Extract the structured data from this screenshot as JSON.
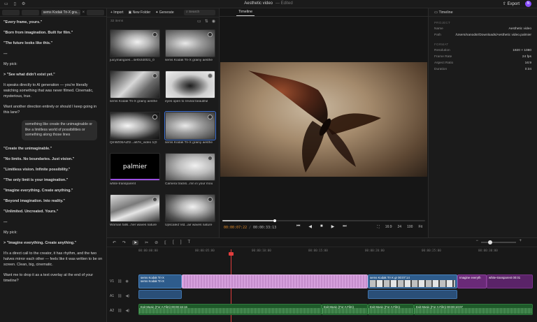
{
  "app": {
    "title": "Aesthetic video",
    "subtitle": "— Edited",
    "export_label": "Export",
    "avatar_initial": "N"
  },
  "chat": {
    "active_tab": "sems Kodak Tri-X gra...",
    "messages": [
      {
        "text": "\"Every frame, yours.\"",
        "bold": true
      },
      {
        "text": "\"Born from imagination. Built for film.\"",
        "bold": true
      },
      {
        "text": "\"The future looks like this.\"",
        "bold": true
      },
      {
        "text": "---",
        "bold": true
      },
      {
        "text": "My pick:",
        "bold": false
      },
      {
        "text": "> \"See what didn't exist yet.\"",
        "bold": true
      },
      {
        "text": "It speaks directly to AI generation — you're literally watching something that was never filmed. Cinematic, mysterious, true.",
        "bold": false
      },
      {
        "text": "Want another direction entirely or should I keep going in this lane?",
        "bold": false
      }
    ],
    "user_bubble": "something like create the unimaginable or like a limitless world of possibilities or something along those lines",
    "messages2": [
      {
        "text": "\"Create the unimaginable.\"",
        "bold": true
      },
      {
        "text": "\"No limits. No boundaries. Just vision.\"",
        "bold": true
      },
      {
        "text": "\"Limitless vision. Infinite possibility.\"",
        "bold": true
      },
      {
        "text": "\"The only limit is your imagination.\"",
        "bold": true
      },
      {
        "text": "\"Imagine everything. Create anything.\"",
        "bold": true
      },
      {
        "text": "\"Beyond imagination. Into reality.\"",
        "bold": true
      },
      {
        "text": "\"Unlimited. Uncreated. Yours.\"",
        "bold": true
      },
      {
        "text": "---",
        "bold": true
      },
      {
        "text": "My pick:",
        "bold": false
      },
      {
        "text": "> \"Imagine everything. Create anything.\"",
        "bold": true
      },
      {
        "text": "It's a direct call to the creator, it has rhythm, and the two halves mirror each other — feels like it was written to be on screen. Clean, big, cinematic.",
        "bold": false
      },
      {
        "text": "Want me to drop it as a text overlay at the end of your timeline?",
        "bold": false
      }
    ]
  },
  "media": {
    "toolbar": {
      "import": "+ Import",
      "new_folder": "New Folder",
      "generate": "Generate",
      "search_placeholder": "Search"
    },
    "sub_label": "32 items",
    "items": [
      {
        "caption": "juicymangoes...4ef0cfd0f21_0",
        "style": "t-bw1"
      },
      {
        "caption": "sems Kodak Tri-X grainy aesthe",
        "style": "t-bw2"
      },
      {
        "caption": "sems Kodak Tri-X grainy aesthe",
        "style": "t-bw3"
      },
      {
        "caption": "eyes open to reveal beautiful",
        "style": "t-eye"
      },
      {
        "caption": "Qm9ZDbAiZfz...a67e_video 1(0",
        "style": "t-face"
      },
      {
        "caption": "sems Kodak Tri-X grainy aesthe",
        "style": "t-bw2"
      },
      {
        "caption": "white-transparent",
        "style": "t-black",
        "text": "palmier"
      },
      {
        "caption": "Camera tracks...mn in your mou",
        "style": "t-bird"
      },
      {
        "caption": "Woman falls...her waves nature",
        "style": "t-hair"
      },
      {
        "caption": "Upscaled Vid...air waves nature",
        "style": "t-bw1"
      }
    ]
  },
  "viewer": {
    "tab": "Timeline",
    "timecode_current": "00:00:07:22",
    "timecode_sep": "/",
    "timecode_duration": "00:00:33:13",
    "progress": 0.25,
    "options": [
      "16:9",
      "24",
      "100",
      "Fit"
    ]
  },
  "inspector": {
    "title": "Timeline",
    "project_section": "PROJECT",
    "project": [
      {
        "k": "Name",
        "v": "Aesthetic video"
      },
      {
        "k": "Path",
        "v": "/Users/nanodsr/Downloads/Aesthetic video.palmier"
      }
    ],
    "format_section": "FORMAT",
    "format": [
      {
        "k": "Resolution",
        "v": "1920 × 1080"
      },
      {
        "k": "Frame Rate",
        "v": "24 fps"
      },
      {
        "k": "Aspect Ratio",
        "v": "16:9"
      },
      {
        "k": "Duration",
        "v": "0:34"
      }
    ]
  },
  "timeline": {
    "ticks": [
      "00:00:00:00",
      "00:00:05:00",
      "00:00:10:00",
      "00:00:15:00",
      "00:00:20:00",
      "00:00:25:00",
      "00:00:30:00"
    ],
    "tracks": [
      "V1",
      "A1",
      "A2"
    ],
    "clips_v1": [
      {
        "label": "sems Kodak Tri-X",
        "label2": "sems Kodak Tri-X",
        "kind": "clip-blue"
      },
      {
        "label": "",
        "kind": "clip-pink"
      },
      {
        "label": "sems Kodak Tri-X gr 00:07:14",
        "label2": "sems Kodak Tri-X gr 00:07:14",
        "kind": "clip-blue"
      },
      {
        "label": "Imagine everyth",
        "kind": "clip-purple"
      },
      {
        "label": "white-transparent 00:01",
        "kind": "clip-purple2"
      }
    ],
    "clips_a2": [
      {
        "label": "Exit Music (For A Film) 00:00:16:16"
      },
      {
        "label": "Exit Music (For A Film)"
      },
      {
        "label": "Exit Music (For A Film)"
      },
      {
        "label": "Exit Music (For A Film) 00:00:10:07"
      }
    ]
  }
}
